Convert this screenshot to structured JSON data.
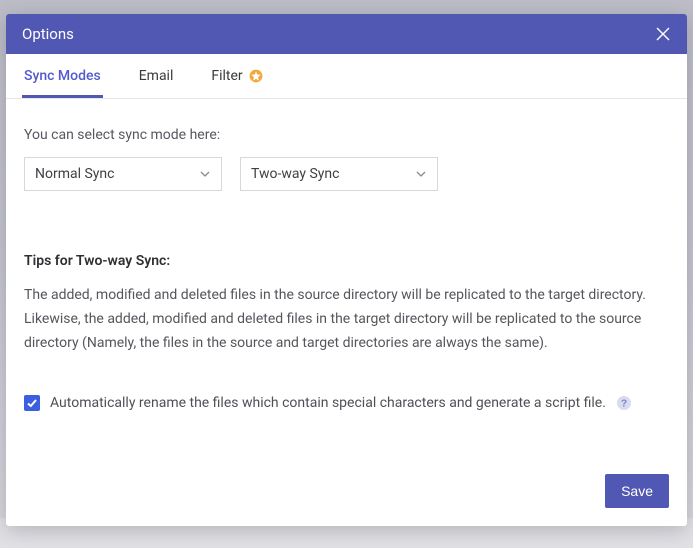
{
  "dialog": {
    "title": "Options"
  },
  "tabs": [
    {
      "label": "Sync Modes"
    },
    {
      "label": "Email"
    },
    {
      "label": "Filter"
    }
  ],
  "instruction": "You can select sync mode here:",
  "selects": {
    "mode1": "Normal Sync",
    "mode2": "Two-way Sync"
  },
  "tips": {
    "heading": "Tips for Two-way Sync:",
    "body": "The added, modified and deleted files in the source directory will be replicated to the target directory. Likewise, the added, modified and deleted files in the target directory will be replicated to the source directory (Namely, the files in the source and target directories are always the same)."
  },
  "checkbox": {
    "label": "Automatically rename the files which contain special characters and generate a script file.",
    "checked": true
  },
  "buttons": {
    "save": "Save"
  },
  "colors": {
    "primary": "#5158b3",
    "accent": "#3b5fe0"
  }
}
